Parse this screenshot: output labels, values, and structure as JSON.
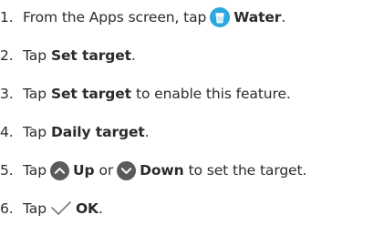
{
  "steps": [
    {
      "number": "1.",
      "parts": {
        "t1": "From the Apps screen, tap",
        "b1": "Water",
        "t2": "."
      },
      "icon": "water-cup-icon"
    },
    {
      "number": "2.",
      "parts": {
        "t1": "Tap",
        "b1": "Set target",
        "t2": "."
      }
    },
    {
      "number": "3.",
      "parts": {
        "t1": "Tap",
        "b1": "Set target",
        "t2": "to enable this feature."
      }
    },
    {
      "number": "4.",
      "parts": {
        "t1": "Tap",
        "b1": "Daily target",
        "t2": "."
      }
    },
    {
      "number": "5.",
      "parts": {
        "t1": "Tap",
        "b1": "Up",
        "t2": "or",
        "b2": "Down",
        "t3": "to set the target."
      },
      "icons": [
        "chevron-up-circle-icon",
        "chevron-down-circle-icon"
      ]
    },
    {
      "number": "6.",
      "parts": {
        "t1": "Tap",
        "b1": "OK",
        "t2": "."
      },
      "icon": "check-icon"
    }
  ],
  "colors": {
    "text": "#2b2b2b",
    "water_icon": "#2aa8df",
    "circle_icon": "#5a5a5a",
    "check_icon": "#7a7a7a"
  }
}
